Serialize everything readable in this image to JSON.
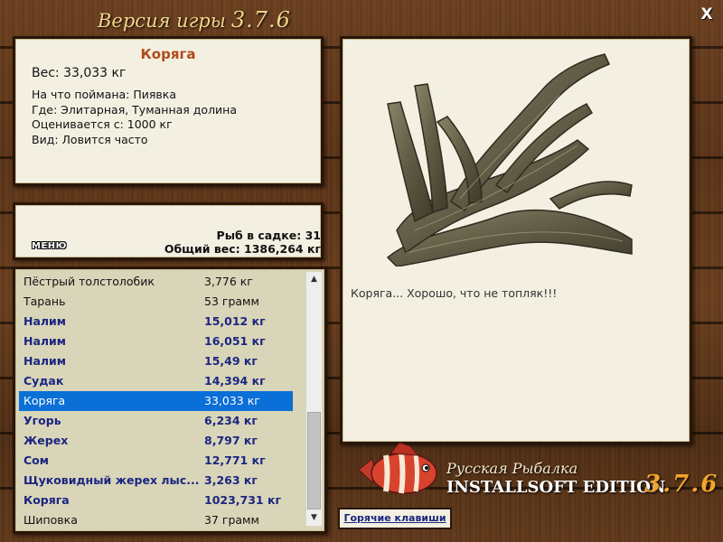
{
  "header": {
    "title": "Версия игры",
    "version": "3.7.6",
    "close_label": "X"
  },
  "info": {
    "name": "Коряга",
    "weight": "Вес: 33,033 кг",
    "details": [
      "На что поймана: Пиявка",
      "Где: Элитарная, Туманная долина",
      "Оценивается с: 1000 кг",
      "Вид: Ловится часто"
    ]
  },
  "stats": {
    "menu_label": "МЕНЮ",
    "fish_count": "Рыб в садке: 31",
    "total_weight": "Общий вес: 1386,264 кг"
  },
  "catch_list": [
    {
      "name": "Пёстрый толстолобик",
      "weight": "3,776 кг",
      "style": "normal"
    },
    {
      "name": "Тарань",
      "weight": "53 грамм",
      "style": "normal"
    },
    {
      "name": "Налим",
      "weight": "15,012 кг",
      "style": "bold"
    },
    {
      "name": "Налим",
      "weight": "16,051 кг",
      "style": "bold"
    },
    {
      "name": "Налим",
      "weight": "15,49 кг",
      "style": "bold"
    },
    {
      "name": "Судак",
      "weight": "14,394 кг",
      "style": "bold"
    },
    {
      "name": "Коряга",
      "weight": "33,033 кг",
      "style": "selected"
    },
    {
      "name": "Угорь",
      "weight": "6,234 кг",
      "style": "bold"
    },
    {
      "name": "Жерех",
      "weight": "8,797 кг",
      "style": "bold"
    },
    {
      "name": "Сом",
      "weight": "12,771 кг",
      "style": "bold"
    },
    {
      "name": "Щуковидный жерех лыс...",
      "weight": "3,263 кг",
      "style": "bold"
    },
    {
      "name": "Коряга",
      "weight": "1023,731 кг",
      "style": "bold"
    },
    {
      "name": "Шиповка",
      "weight": "37 грамм",
      "style": "normal"
    }
  ],
  "scrollbar": {
    "up_icon": "▲",
    "down_icon": "▼"
  },
  "image": {
    "caption": "Коряга... Хорошо, что не топляк!!!"
  },
  "logo": {
    "line1": "Русская Рыбалка",
    "line2": "INSTALLSOFT EDITION",
    "version": "3.7.6"
  },
  "hotkeys": {
    "label": "Горячие клавиши"
  },
  "colors": {
    "selection": "#0a6fd6",
    "bold_text": "#1b2680",
    "name_accent": "#b04a1a"
  }
}
